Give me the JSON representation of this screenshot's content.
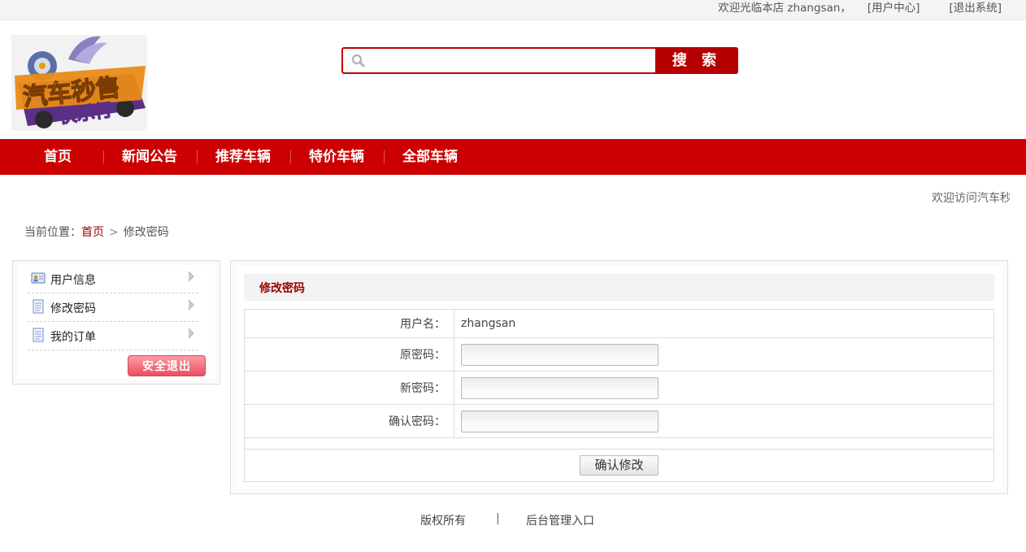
{
  "topbar": {
    "welcome_text": "欢迎光临本店 zhangsan，",
    "user_center": "[用户中心]",
    "logout": "[退出系统]"
  },
  "logo": {
    "line1": "汽车秒售",
    "line2": "快乐行"
  },
  "search": {
    "placeholder": "",
    "value": "",
    "button_label": "搜 索"
  },
  "nav": {
    "items": [
      {
        "label": "首页"
      },
      {
        "label": "新闻公告"
      },
      {
        "label": "推荐车辆"
      },
      {
        "label": "特价车辆"
      },
      {
        "label": "全部车辆"
      }
    ]
  },
  "marquee": {
    "text": "欢迎访问汽车秒售"
  },
  "breadcrumb": {
    "prefix": "当前位置：",
    "home": "首页",
    "separator": ">",
    "current": "修改密码"
  },
  "sidebar": {
    "items": [
      {
        "label": "用户信息",
        "icon": "id-card-icon"
      },
      {
        "label": "修改密码",
        "icon": "document-icon"
      },
      {
        "label": "我的订单",
        "icon": "document-icon"
      }
    ],
    "logout_label": "安全退出"
  },
  "form": {
    "title": "修改密码",
    "username_label": "用户名：",
    "username_value": "zhangsan",
    "old_password_label": "原密码：",
    "new_password_label": "新密码：",
    "confirm_password_label": "确认密码：",
    "submit_label": "确认修改"
  },
  "footer": {
    "copyright": "版权所有",
    "separator": "|",
    "admin_link": "后台管理入口"
  },
  "colors": {
    "brand_red": "#cc0000",
    "title_red": "#990000"
  }
}
